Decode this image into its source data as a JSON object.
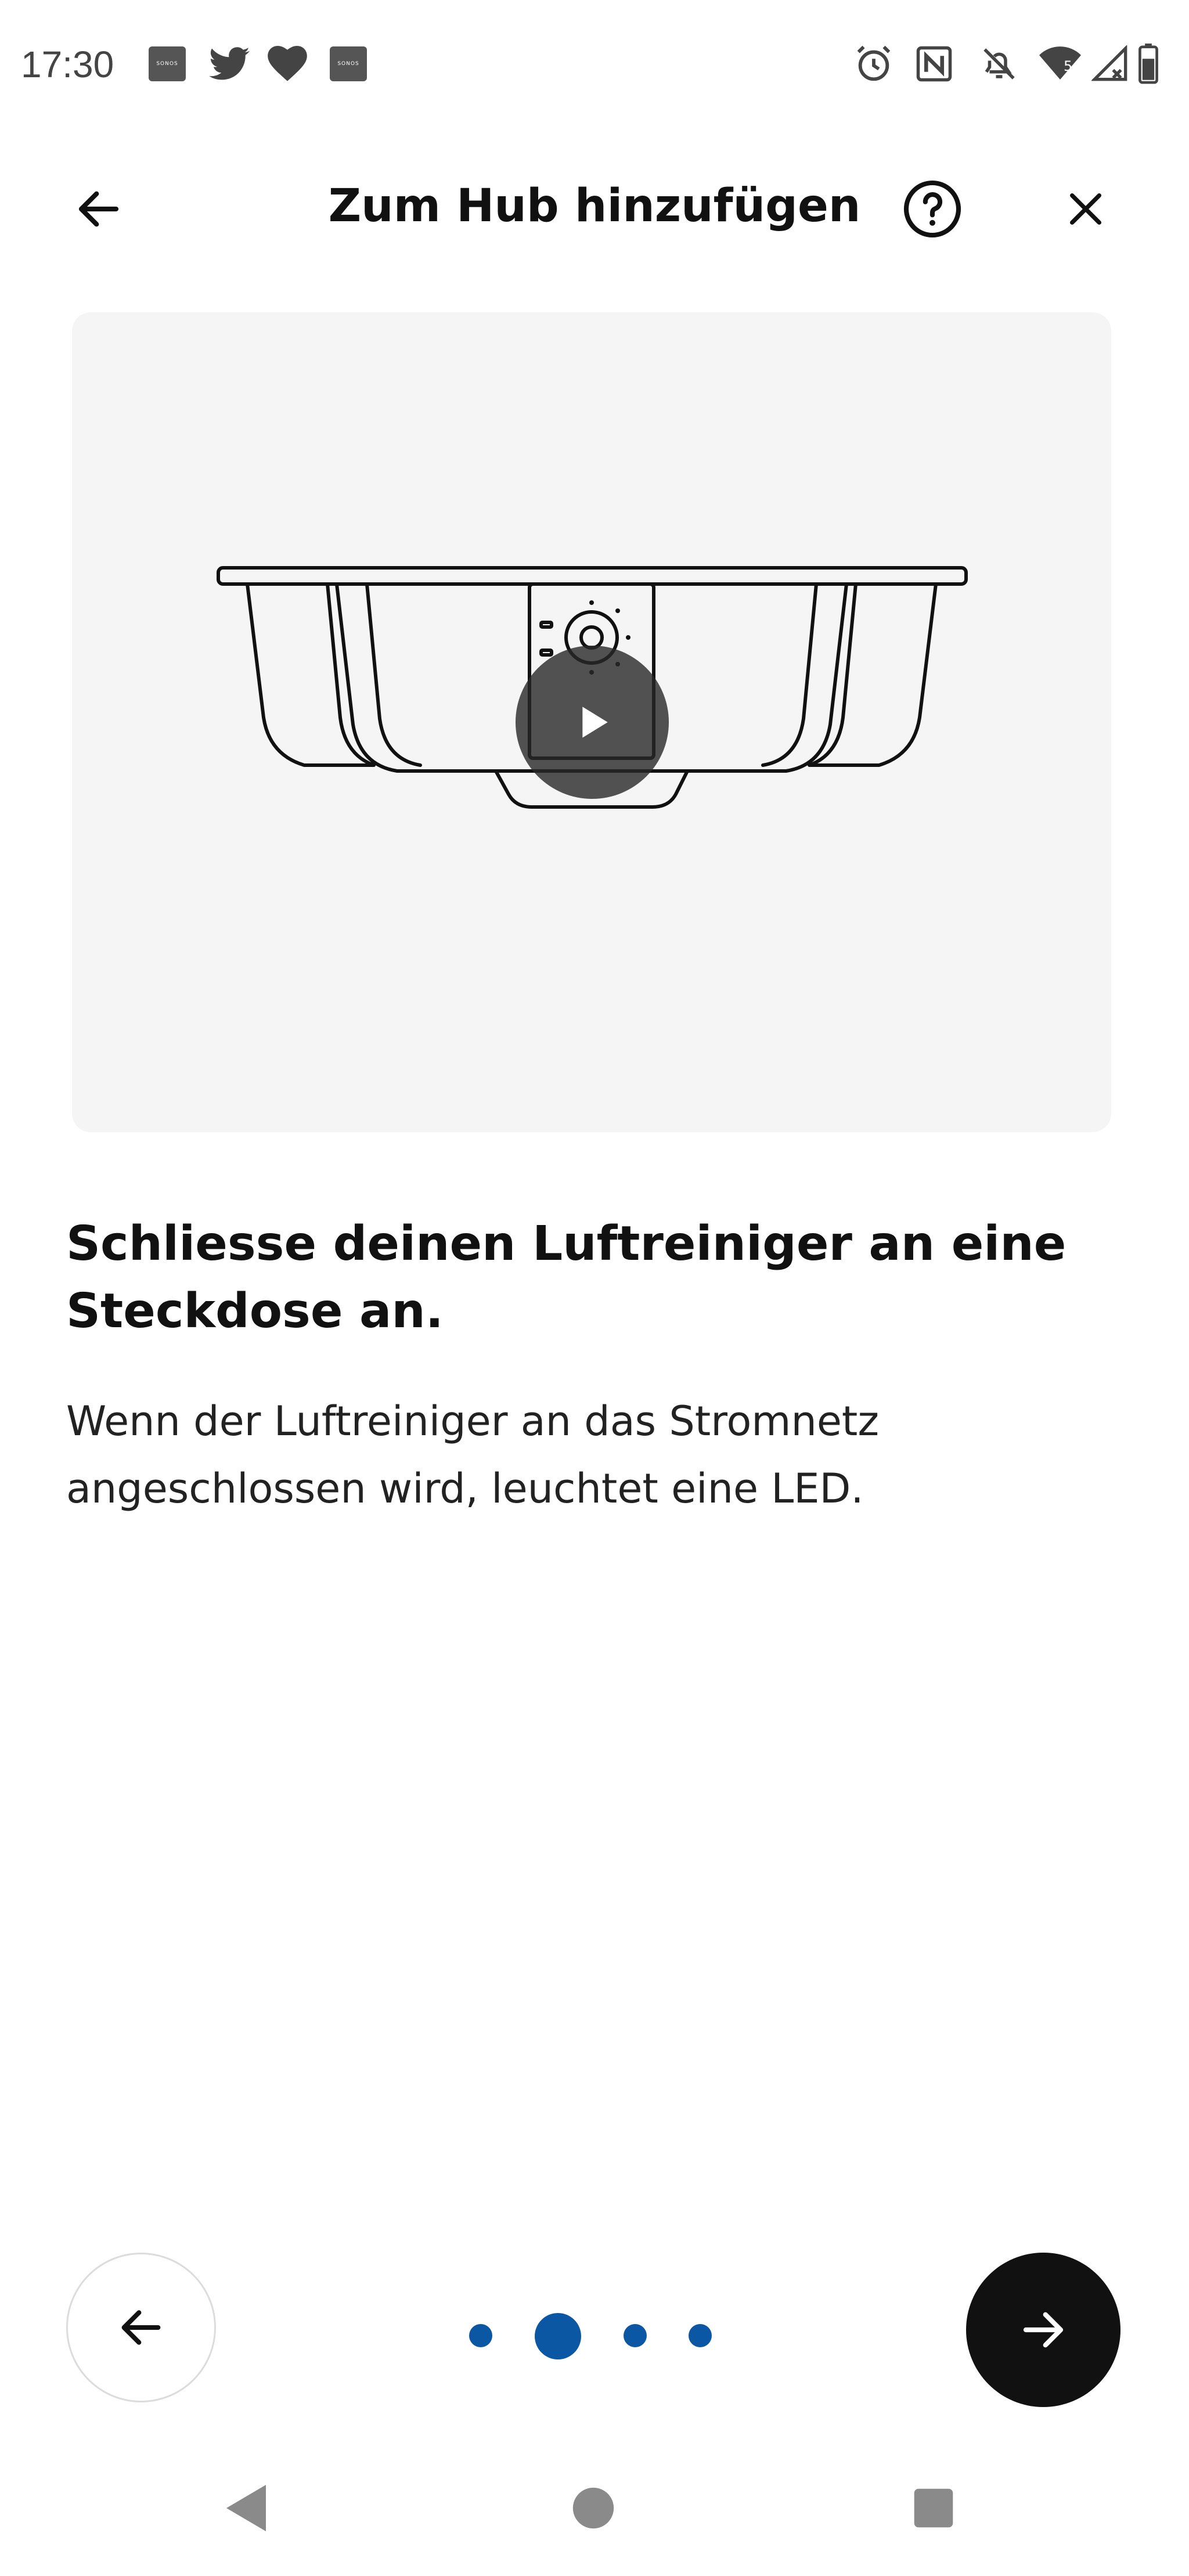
{
  "status_bar": {
    "time": "17:30",
    "left_icons": [
      "sonos-icon",
      "twitter-icon",
      "heart-icon",
      "sonos-icon"
    ],
    "right_icons": [
      "alarm-icon",
      "nfc-icon",
      "bell-off-icon",
      "wifi-icon",
      "signal-icon",
      "battery-icon"
    ],
    "sonos_text": "SONOS",
    "wifi_badge": "5"
  },
  "header": {
    "title": "Zum Hub hinzufügen",
    "back_icon": "arrow-left-icon",
    "help_icon": "help-circle-icon",
    "close_icon": "close-icon"
  },
  "media": {
    "play_icon": "play-icon"
  },
  "content": {
    "heading": "Schliesse deinen Luftreiniger an eine Steckdose an.",
    "body": "Wenn der Luftreiniger an das Stromnetz angeschlossen wird, leuchtet eine LED."
  },
  "pager": {
    "total": 4,
    "current": 2
  },
  "colors": {
    "accent": "#0b57a4",
    "primary_button": "#111111",
    "media_bg": "#f5f5f5"
  }
}
